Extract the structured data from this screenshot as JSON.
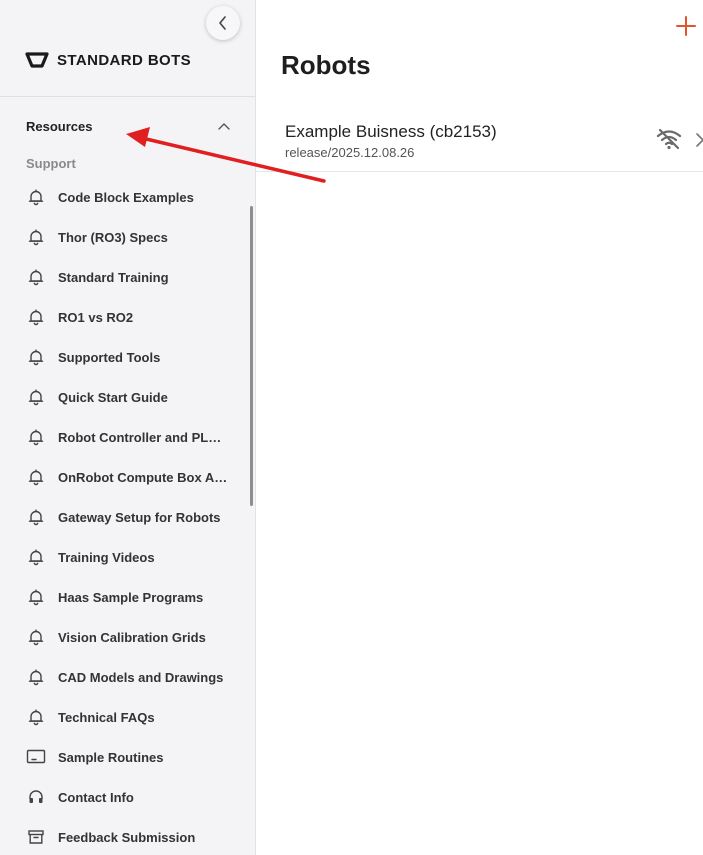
{
  "sidebar": {
    "logo_text": "STANDARD BOTS",
    "section_title": "Resources",
    "group_label": "Support",
    "items": [
      {
        "label": "Code Block Examples",
        "icon": "bell-icon"
      },
      {
        "label": "Thor (RO3) Specs",
        "icon": "bell-icon"
      },
      {
        "label": "Standard Training",
        "icon": "bell-icon"
      },
      {
        "label": "RO1 vs RO2",
        "icon": "bell-icon"
      },
      {
        "label": "Supported Tools",
        "icon": "bell-icon"
      },
      {
        "label": "Quick Start Guide",
        "icon": "bell-icon"
      },
      {
        "label": "Robot Controller and PLC Integration",
        "icon": "bell-icon"
      },
      {
        "label": "OnRobot Compute Box Adapter",
        "icon": "bell-icon"
      },
      {
        "label": "Gateway Setup for Robots",
        "icon": "bell-icon"
      },
      {
        "label": "Training Videos",
        "icon": "bell-icon"
      },
      {
        "label": "Haas Sample Programs",
        "icon": "bell-icon"
      },
      {
        "label": "Vision Calibration Grids",
        "icon": "bell-icon"
      },
      {
        "label": "CAD Models and Drawings",
        "icon": "bell-icon"
      },
      {
        "label": "Technical FAQs",
        "icon": "bell-icon"
      },
      {
        "label": "Sample Routines",
        "icon": "monitor-icon"
      },
      {
        "label": "Contact Info",
        "icon": "headset-icon"
      },
      {
        "label": "Feedback Submission",
        "icon": "archive-box-icon"
      }
    ]
  },
  "main": {
    "title": "Robots",
    "robots": [
      {
        "name": "Example Buisness (cb2153)",
        "version": "release/2025.12.08.26",
        "status_icon": "wifi-off-icon"
      }
    ]
  },
  "colors": {
    "accent": "#e0562a",
    "annotation_arrow": "#e02020",
    "sidebar_bg": "#f4f4f6"
  }
}
